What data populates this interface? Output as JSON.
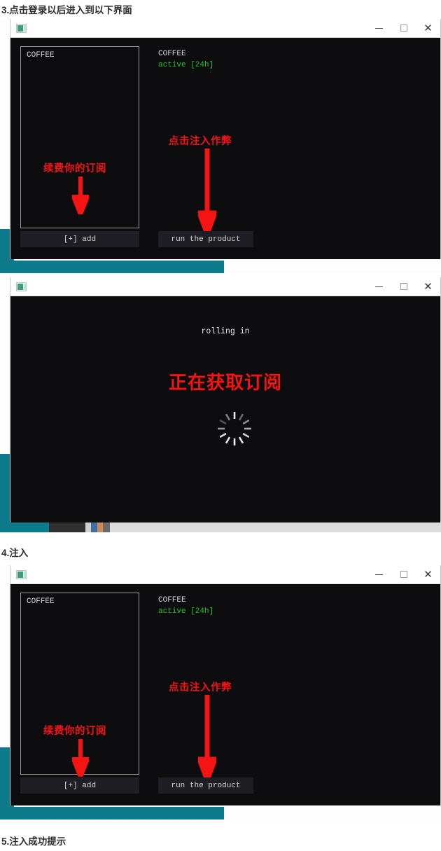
{
  "document": {
    "steps": [
      {
        "id": "step3",
        "label": "3.点击登录以后进入到以下界面"
      },
      {
        "id": "step4",
        "label": "4.注入"
      },
      {
        "id": "step5",
        "label": "5.注入成功提示"
      }
    ]
  },
  "colors": {
    "accent_green": "#22c522",
    "annotation_red": "#f41414",
    "terminal_bg": "#0d0d10",
    "desktop_teal": "#0e7b8c",
    "button_bg": "#1e1e24"
  },
  "window": {
    "title": "",
    "icon": "app-window-icon",
    "controls": {
      "minimize": "minimize-icon",
      "maximize": "maximize-icon",
      "close": "close-icon"
    }
  },
  "app_main": {
    "sidebar": {
      "items": [
        {
          "label": "COFFEE"
        }
      ],
      "add_button": "[+] add"
    },
    "detail": {
      "title": "COFFEE",
      "status": "active [24h]"
    },
    "run_button": "run the product",
    "annotations": {
      "renew": "续费你的订阅",
      "inject": "点击注入作弊"
    }
  },
  "app_loading": {
    "header": "rolling in",
    "message": "正在获取订阅",
    "spinner": "loading-spinner-icon"
  }
}
